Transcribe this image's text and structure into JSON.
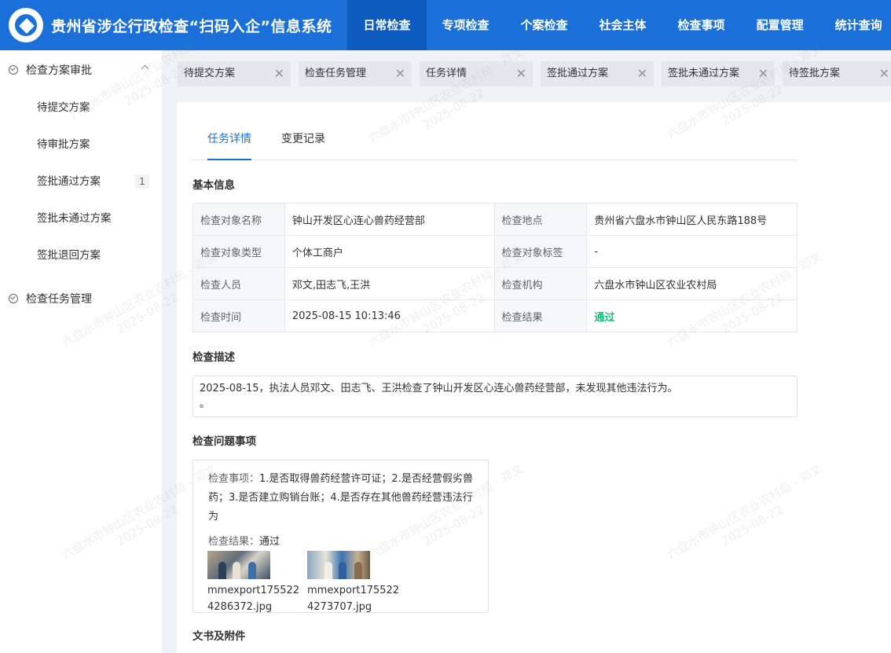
{
  "header": {
    "app_title": "贵州省涉企行政检查“扫码入企”信息系统",
    "nav": [
      "日常检查",
      "专项检查",
      "个案检查",
      "社会主体",
      "检查事项",
      "配置管理",
      "统计查询"
    ],
    "active_index": 0
  },
  "sidebar": {
    "group1": "检查方案审批",
    "items": [
      {
        "label": "待提交方案"
      },
      {
        "label": "待审批方案"
      },
      {
        "label": "签批通过方案",
        "badge": "1"
      },
      {
        "label": "签批未通过方案"
      },
      {
        "label": "签批退回方案"
      }
    ],
    "group2": "检查任务管理"
  },
  "tabs": [
    "待提交方案",
    "检查任务管理",
    "任务详情",
    "签批通过方案",
    "签批未通过方案",
    "待签批方案"
  ],
  "subtabs": {
    "detail": "任务详情",
    "history": "变更记录"
  },
  "basic_info": {
    "title": "基本信息",
    "rows": [
      {
        "l1": "检查对象名称",
        "v1": "钟山开发区心连心兽药经营部",
        "l2": "检查地点",
        "v2": "贵州省六盘水市钟山区人民东路188号"
      },
      {
        "l1": "检查对象类型",
        "v1": "个体工商户",
        "l2": "检查对象标签",
        "v2": "-"
      },
      {
        "l1": "检查人员",
        "v1": "邓文,田志飞,王洪",
        "l2": "检查机构",
        "v2": "六盘水市钟山区农业农村局"
      },
      {
        "l1": "检查时间",
        "v1": "2025-08-15 10:13:46",
        "l2": "检查结果",
        "v2": "通过"
      }
    ]
  },
  "description": {
    "title": "检查描述",
    "line1": "2025-08-15，执法人员邓文、田志飞、王洪检查了钟山开发区心连心兽药经营部，未发现其他违法行为。",
    "line2": "。"
  },
  "issues": {
    "title": "检查问题事项",
    "item_label": "检查事项：",
    "item_text": "1.是否取得兽药经营许可证；2.是否经营假劣兽药；3.是否建立购销台账；4.是否存在其他兽药经营违法行为",
    "result_label": "检查结果：",
    "result_value": "通过",
    "photos": [
      {
        "name": "mmexport1755224286372.jpg"
      },
      {
        "name": "mmexport1755224273707.jpg"
      }
    ]
  },
  "attachments": {
    "title": "文书及附件"
  },
  "watermark": {
    "line1": "六盘水市钟山区农业农村局 - 邓文",
    "line2": "2025-08-22"
  },
  "colors": {
    "primary": "#1a6fd8",
    "active_nav": "#0e5bbf",
    "pass": "#13c07a"
  }
}
